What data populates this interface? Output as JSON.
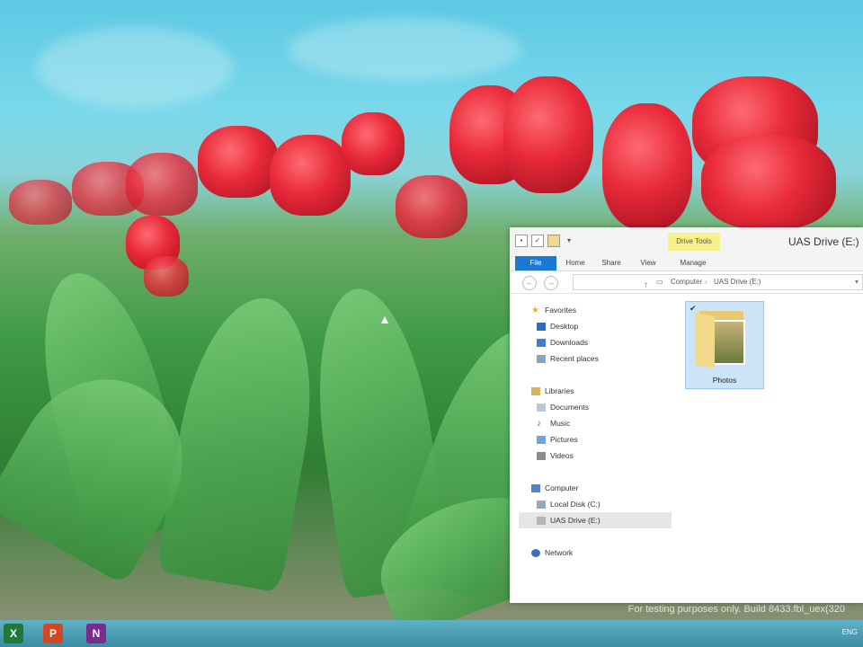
{
  "window": {
    "title": "UAS Drive (E:)",
    "context_tab": "Drive Tools",
    "ribbon_tabs": [
      "File",
      "Home",
      "Share",
      "View",
      "Manage"
    ]
  },
  "address": {
    "segments": [
      "Computer",
      "UAS Drive (E:)"
    ]
  },
  "nav": {
    "favorites": {
      "label": "Favorites",
      "items": [
        "Desktop",
        "Downloads",
        "Recent places"
      ]
    },
    "libraries": {
      "label": "Libraries",
      "items": [
        "Documents",
        "Music",
        "Pictures",
        "Videos"
      ]
    },
    "computer": {
      "label": "Computer",
      "items": [
        "Local Disk (C:)",
        "UAS Drive (E:)"
      ]
    },
    "network": {
      "label": "Network"
    }
  },
  "content": {
    "folders": [
      {
        "name": "Photos"
      }
    ]
  },
  "watermark": "For testing purposes only. Build 8433.fbl_uex(320",
  "taskbar": {
    "apps": [
      "excel-icon",
      "powerpoint-icon",
      "onenote-icon"
    ],
    "tray_text": "ENG"
  },
  "colors": {
    "accent": "#1a79d6",
    "selection": "#cce4f7",
    "context_tab": "#f7f18c"
  }
}
